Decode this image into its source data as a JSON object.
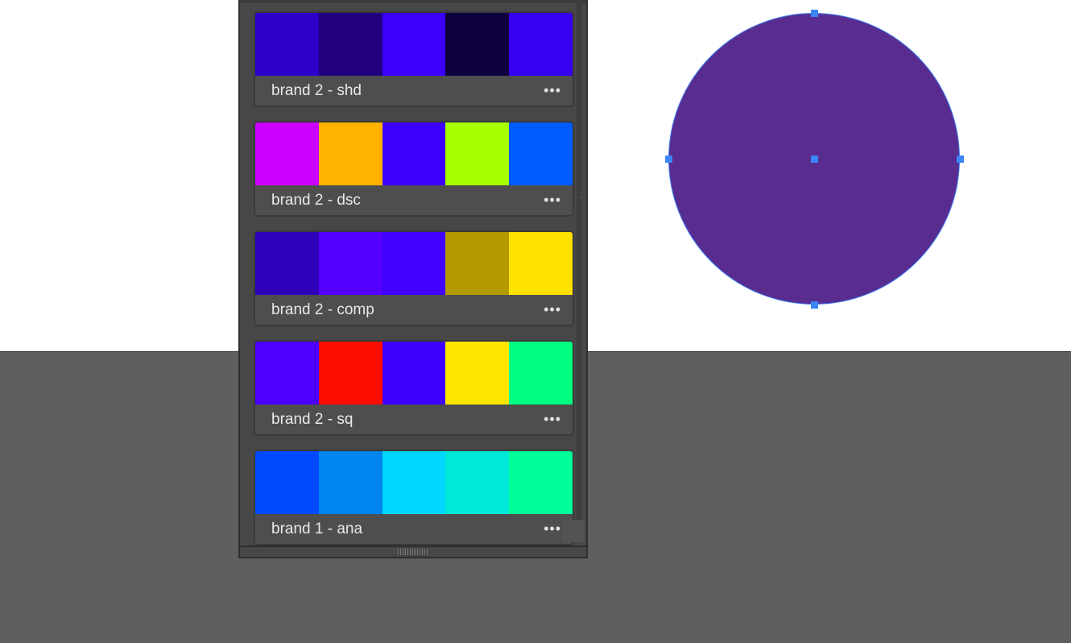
{
  "panel": {
    "themes": [
      {
        "name": "brand 2 - shd",
        "more": "•••",
        "colors": [
          "#2c00c8",
          "#21007f",
          "#3c00ff",
          "#0e003f",
          "#3600f0"
        ]
      },
      {
        "name": "brand 2 - dsc",
        "more": "•••",
        "colors": [
          "#cc00ff",
          "#ffb200",
          "#3c00ff",
          "#a8ff00",
          "#005cff"
        ]
      },
      {
        "name": "brand 2 - comp",
        "more": "•••",
        "colors": [
          "#2e00ba",
          "#5500ff",
          "#4100ff",
          "#b59900",
          "#ffe100"
        ]
      },
      {
        "name": "brand 2 - sq",
        "more": "•••",
        "colors": [
          "#4d00ff",
          "#ff0d00",
          "#3e00ff",
          "#ffe600",
          "#00ff80"
        ]
      },
      {
        "name": "brand 1 - ana",
        "more": "•••",
        "colors": [
          "#0049ff",
          "#0084f0",
          "#00d8ff",
          "#00e8d8",
          "#00ff99"
        ]
      }
    ]
  },
  "canvas": {
    "shape": "circle",
    "fill": "#592d8f",
    "selection_color": "#3d86f7"
  }
}
